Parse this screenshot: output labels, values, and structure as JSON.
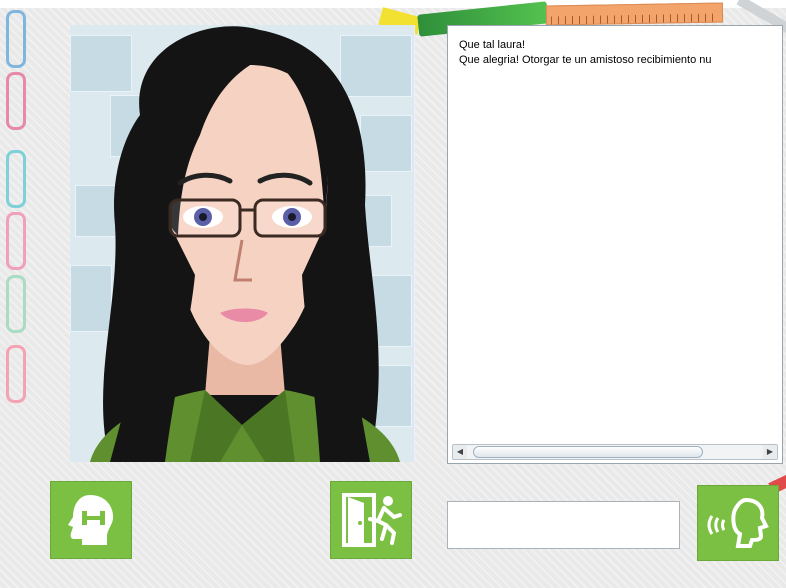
{
  "chat": {
    "lines": [
      "Que tal laura!",
      "Que alegria! Otorgar te un amistoso recibimiento nu"
    ]
  },
  "input": {
    "value": "",
    "placeholder": ""
  },
  "icons": {
    "brain": "head-brain-icon",
    "exit": "exit-door-icon",
    "speak": "speaking-head-icon"
  },
  "colors": {
    "accent": "#7cc043",
    "panel_bg": "#dceaf0",
    "hair": "#141414",
    "skin": "#f6d2c2"
  }
}
